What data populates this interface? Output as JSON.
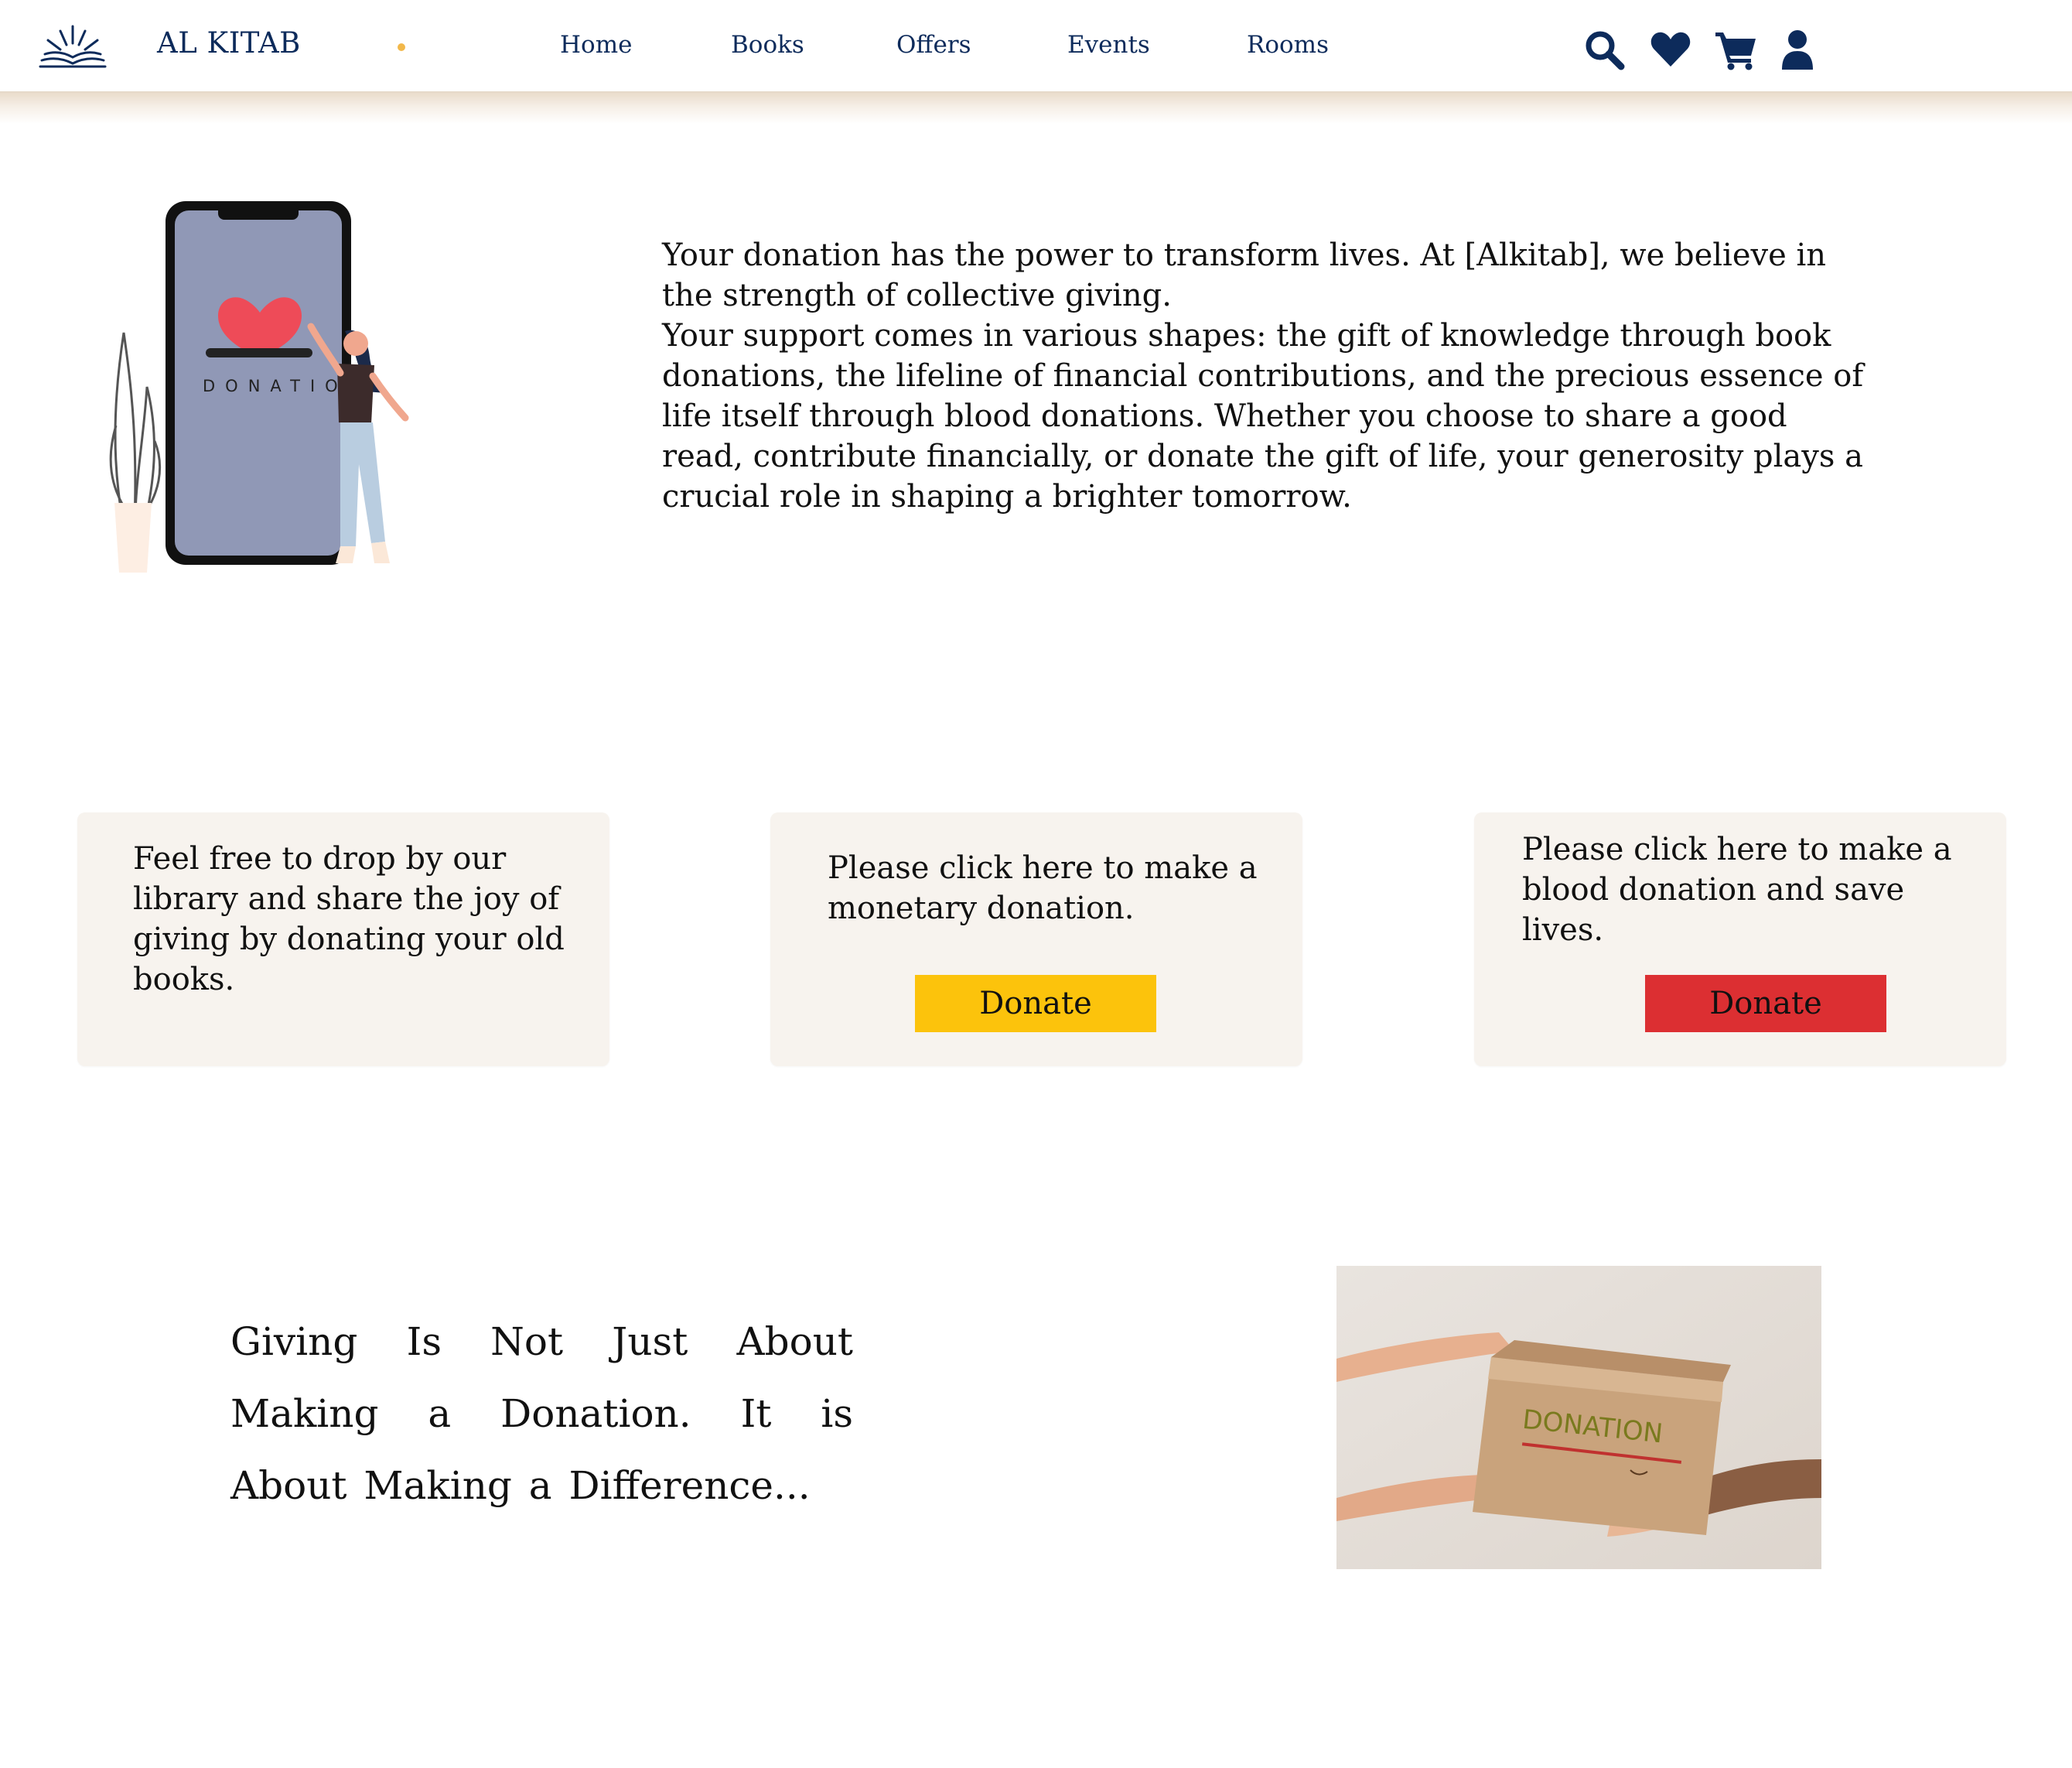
{
  "header": {
    "brand": "AL KITAB",
    "nav": [
      "Home",
      "Books",
      "Offers",
      "Events",
      "Rooms"
    ],
    "icons": [
      "search-icon",
      "heart-icon",
      "cart-icon",
      "user-icon"
    ]
  },
  "intro": {
    "illustration_text": "DONATION",
    "paragraph1": "Your donation has the power to transform lives. At [Alkitab], we believe in the strength of collective giving.",
    "paragraph2": "Your support comes in various shapes: the gift of knowledge through book donations, the lifeline of financial contributions, and the precious essence of life itself through blood donations. Whether you choose to share a good read, contribute financially, or donate the gift of life, your generosity plays a crucial role in shaping a brighter tomorrow."
  },
  "cards": [
    {
      "text": "Feel free to drop by our library and share the joy of giving by donating your old books."
    },
    {
      "text": "Please click here to make a monetary donation.",
      "button": "Donate",
      "button_color": "#fcc30c"
    },
    {
      "text": "Please click here to make a blood donation and save lives.",
      "button": "Donate",
      "button_color": "#dc2f32"
    }
  ],
  "quote": "Giving Is Not Just About Making a Donation. It is About Making a Difference...",
  "photo": {
    "box_text": "DONATION"
  },
  "colors": {
    "navy": "#0d2b5b",
    "card_bg": "#f7f3ee",
    "accent_dot": "#f2b84a"
  }
}
